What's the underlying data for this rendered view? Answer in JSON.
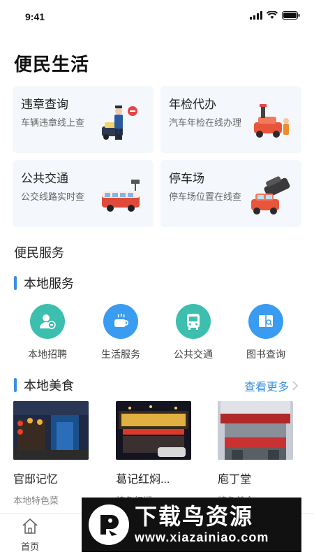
{
  "status_bar": {
    "time": "9:41"
  },
  "page_title": "便民生活",
  "life_cards": [
    {
      "title": "违章查询",
      "subtitle": "车辆违章线上查"
    },
    {
      "title": "年检代办",
      "subtitle": "汽车年检在线办理"
    },
    {
      "title": "公共交通",
      "subtitle": "公交线路实时查"
    },
    {
      "title": "停车场",
      "subtitle": "停车场位置在线查"
    }
  ],
  "services_section": {
    "title": "便民服务"
  },
  "local_services": {
    "header": "本地服务",
    "items": [
      {
        "label": "本地招聘",
        "icon": "recruit-icon",
        "color": "#3cbfae"
      },
      {
        "label": "生活服务",
        "icon": "coffee-cup-icon",
        "color": "#3a9cf0"
      },
      {
        "label": "公共交通",
        "icon": "bus-icon",
        "color": "#3cbfae"
      },
      {
        "label": "图书查询",
        "icon": "book-search-icon",
        "color": "#3a9cf0"
      }
    ]
  },
  "local_food": {
    "header": "本地美食",
    "see_more": "查看更多",
    "items": [
      {
        "name": "官邸记忆",
        "tag": "本地特色菜"
      },
      {
        "name": "葛记红焖...",
        "tag": "特色红焖"
      },
      {
        "name": "庖丁堂",
        "tag": "特色美食"
      }
    ]
  },
  "tab_bar": {
    "home_label": "首页"
  },
  "watermark": {
    "cn": "下载鸟资源",
    "url": "www.xiazainiao.com"
  },
  "colors": {
    "accent": "#3a8ee6",
    "card_bg": "#f4f7fb",
    "teal": "#3cbfae",
    "blue": "#3a9cf0"
  }
}
